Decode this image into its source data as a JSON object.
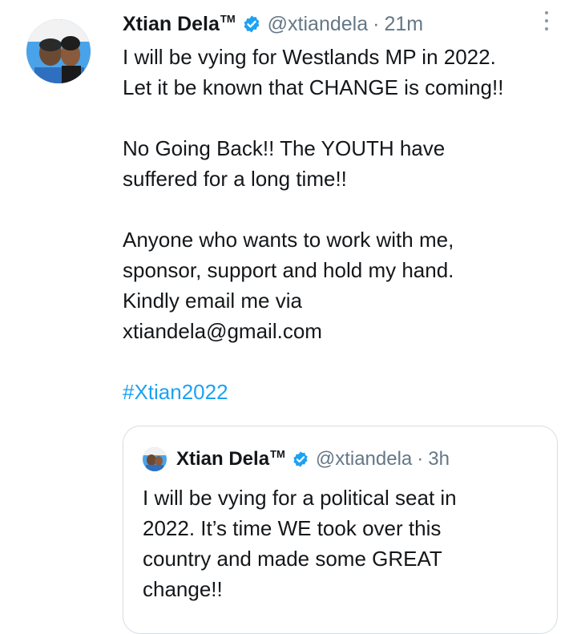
{
  "tweet": {
    "author_name": "Xtian Dela",
    "trademark": "TM",
    "handle": "@xtiandela",
    "separator": "·",
    "time": "21m",
    "lines": [
      "I will be vying for Westlands MP in 2022.",
      "Let it be known that CHANGE is coming!!"
    ],
    "para2_lines": [
      "No Going Back!! The YOUTH have",
      "suffered for a long time!!"
    ],
    "para3_lines": [
      "Anyone who wants to work with me,",
      "sponsor, support and hold my hand.",
      "Kindly email me via",
      "xtiandela@gmail.com"
    ],
    "hashtag": "#Xtian2022"
  },
  "quoted": {
    "author_name": "Xtian Dela",
    "trademark": "TM",
    "handle": "@xtiandela",
    "separator": "·",
    "time": "3h",
    "lines": [
      "I will be vying for a political seat in",
      "2022. It’s time WE took over this",
      "country and made some GREAT",
      "change!!"
    ]
  },
  "icons": {
    "verified": "verified-badge-icon",
    "more": "more-vertical-icon"
  },
  "colors": {
    "link": "#1da1f2",
    "verified": "#1da1f2",
    "secondary_text": "#657786",
    "border": "#d6dde3"
  }
}
